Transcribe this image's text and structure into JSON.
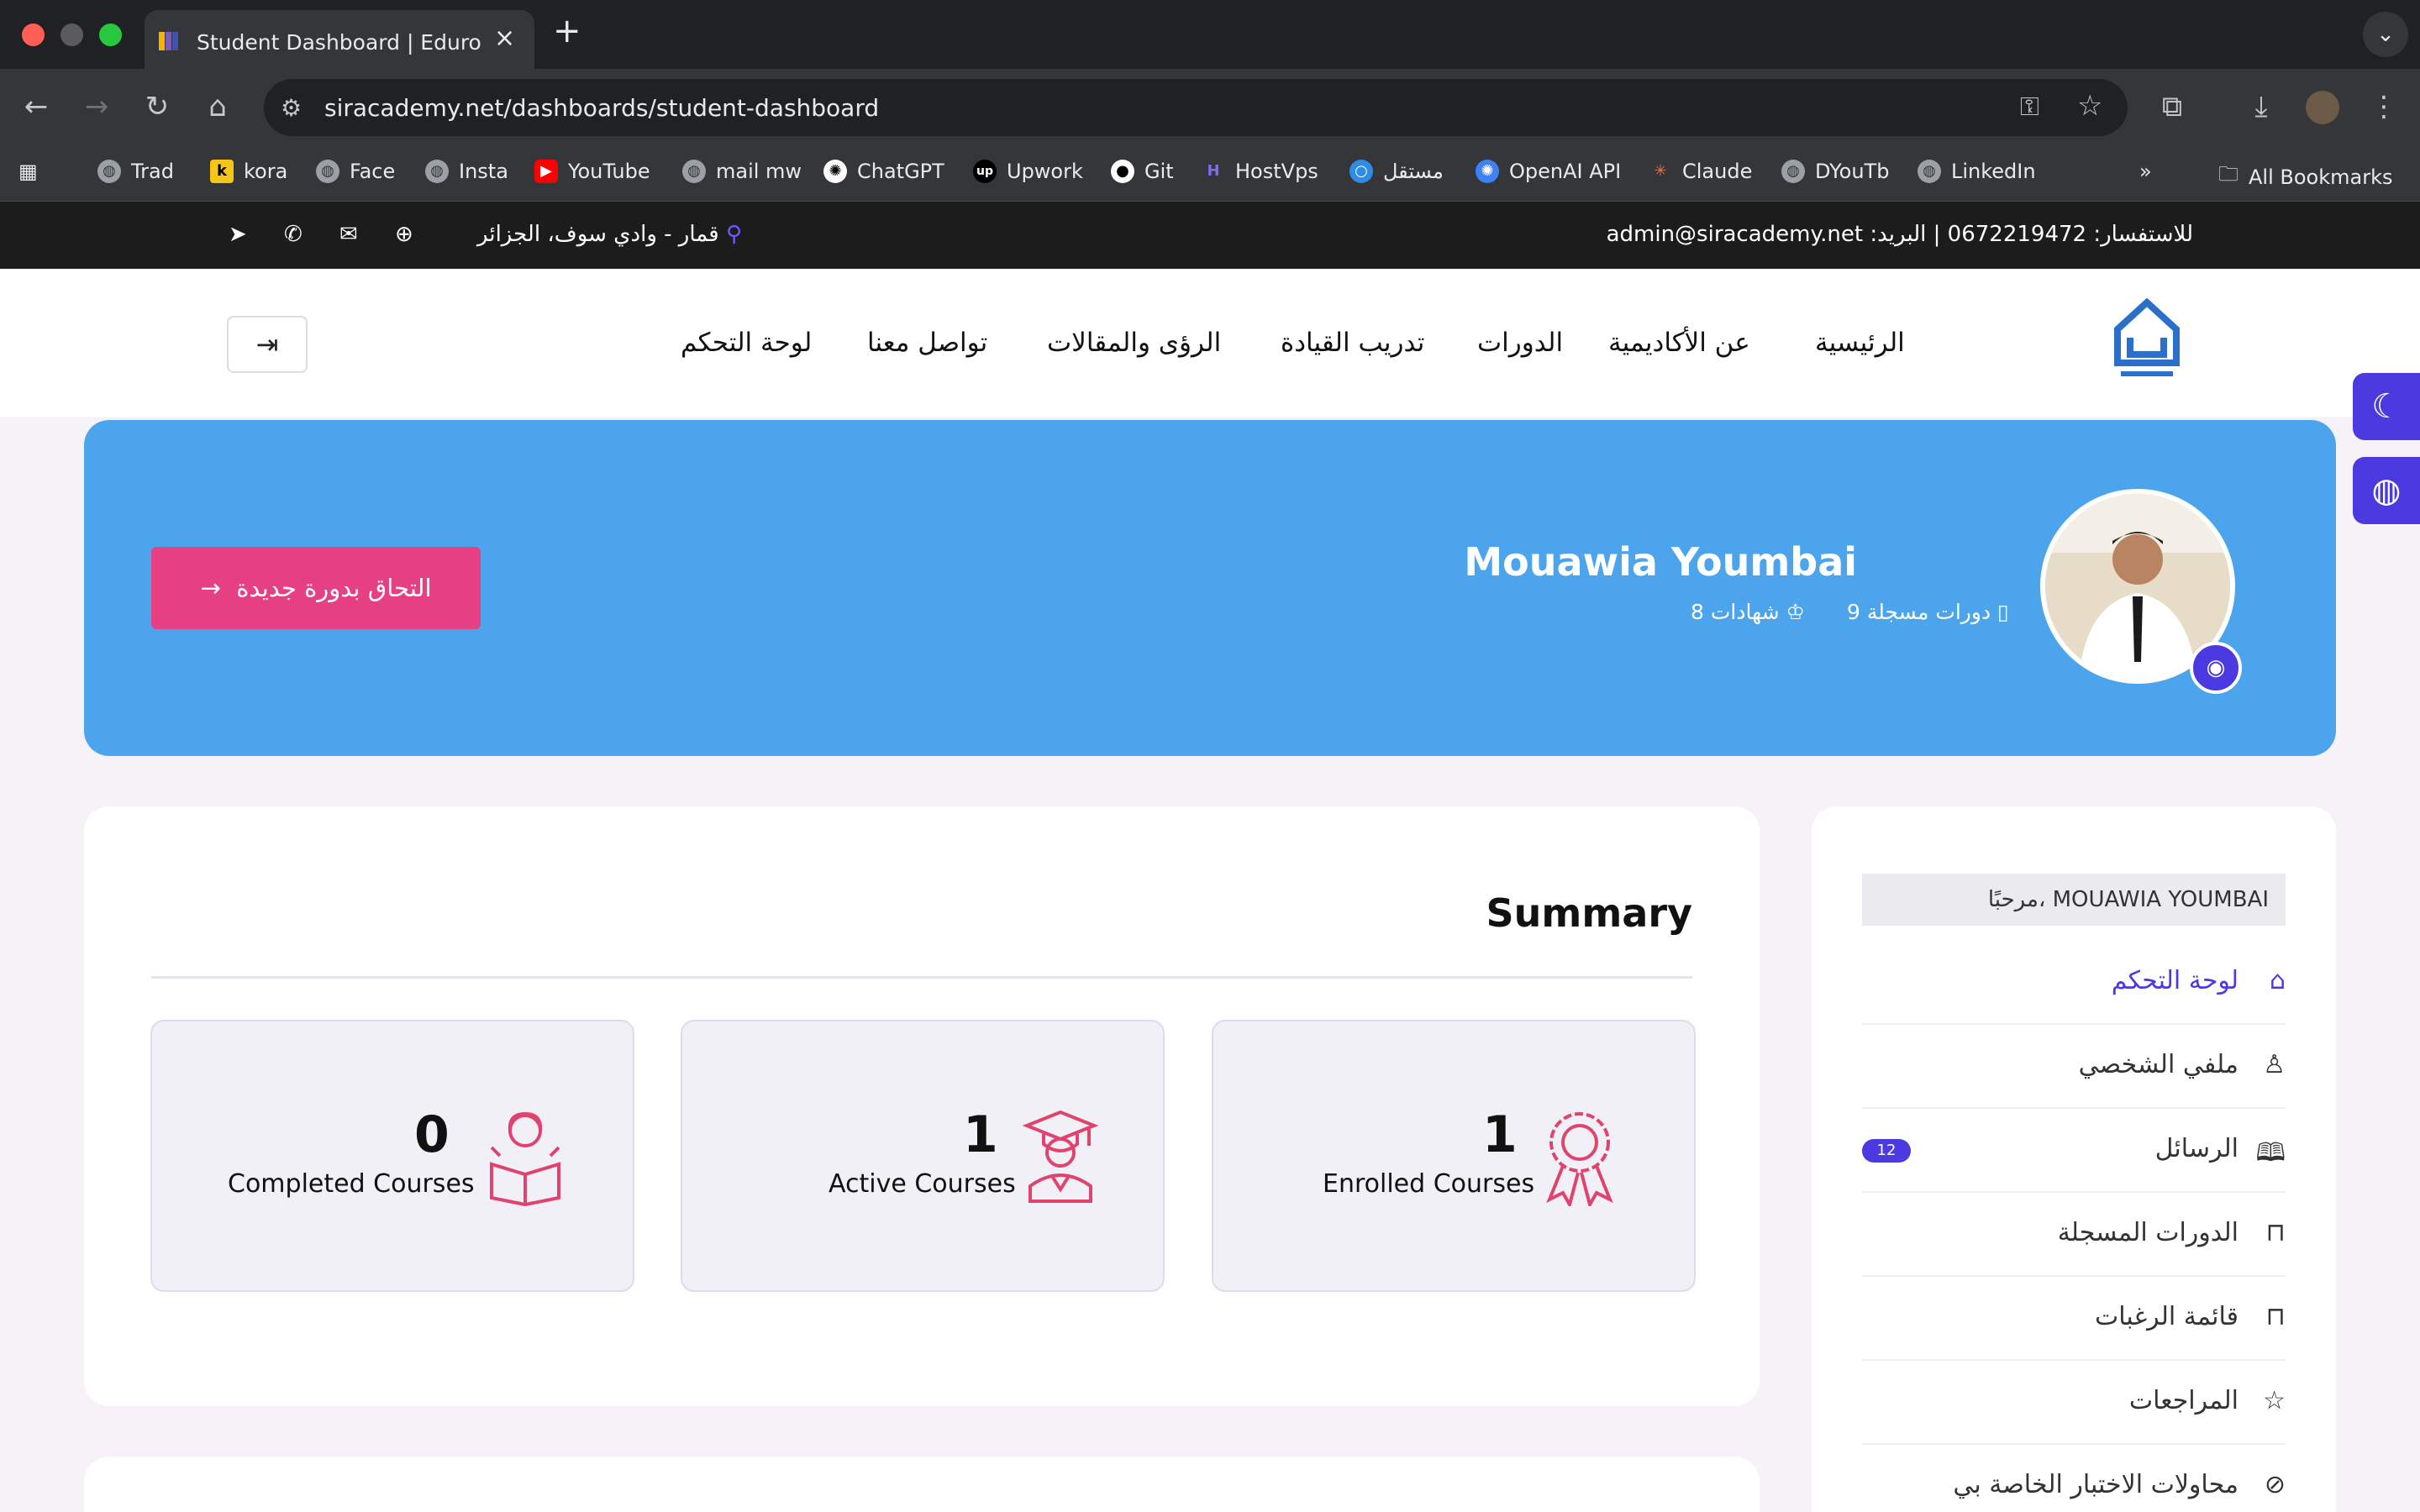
{
  "browser": {
    "tab_title": "Student Dashboard | Edurock",
    "url": "siracademy.net/dashboards/student-dashboard",
    "bookmarks": [
      "Trad",
      "kora",
      "Face",
      "Insta",
      "YouTube",
      "mail mw",
      "ChatGPT",
      "Upwork",
      "Git",
      "HostVps",
      "مستقل",
      "OpenAI API",
      "Claude",
      "DYouTb",
      "LinkedIn"
    ],
    "all_bookmarks": "All Bookmarks",
    "overflow": "»"
  },
  "topbar": {
    "contact": "للاستفسار: 0672219472 | البريد: admin@siracademy.net",
    "location": "قمار - وادي سوف، الجزائر"
  },
  "nav": {
    "items": [
      "الرئيسية",
      "عن الأكاديمية",
      "الدورات",
      "تدريب القيادة",
      "الرؤى والمقالات",
      "تواصل معنا",
      "لوحة التحكم"
    ]
  },
  "hero": {
    "name": "Mouawia Youmbai",
    "courses_meta": "9 دورات مسجلة",
    "certs_meta": "8 شهادات",
    "cta_label": "التحاق بدورة جديدة"
  },
  "summary": {
    "title": "Summary",
    "stats": [
      {
        "value": "1",
        "label": "Enrolled Courses",
        "icon": "award-icon"
      },
      {
        "value": "1",
        "label": "Active Courses",
        "icon": "graduate-icon"
      },
      {
        "value": "0",
        "label": "Completed Courses",
        "icon": "reader-icon"
      }
    ]
  },
  "sidebar": {
    "welcome": "مرحبًا، MOUAWIA YOUMBAI",
    "items": [
      {
        "label": "لوحة التحكم",
        "icon": "home-icon"
      },
      {
        "label": "ملفي الشخصي",
        "icon": "user-icon"
      },
      {
        "label": "الرسائل",
        "icon": "book-icon",
        "badge": "12"
      },
      {
        "label": "الدورات المسجلة",
        "icon": "bookmark-icon"
      },
      {
        "label": "قائمة الرغبات",
        "icon": "bookmark-icon"
      },
      {
        "label": "المراجعات",
        "icon": "star-icon"
      },
      {
        "label": "محاولات الاختبار الخاصة بي",
        "icon": "help-circle-icon"
      }
    ]
  },
  "colors": {
    "accent": "#4b3ae0",
    "hero_bg": "#4ca5ec",
    "cta": "#e63f83",
    "stat_icon": "#e0446e"
  }
}
